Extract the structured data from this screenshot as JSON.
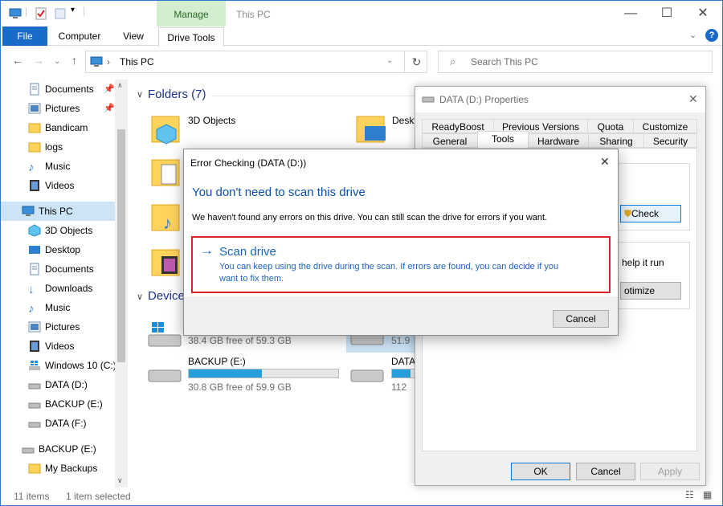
{
  "window": {
    "title": "This PC",
    "manage_tab": "Manage",
    "controls": {
      "minimize": "—",
      "maximize": "☐",
      "close": "✕"
    }
  },
  "ribbon": {
    "tabs": [
      "File",
      "Computer",
      "View",
      "Drive Tools"
    ],
    "help": "?"
  },
  "address": {
    "path": "This PC",
    "search_placeholder": "Search This PC"
  },
  "sidebar": {
    "quick_access": [
      {
        "label": "Documents",
        "icon": "documents-icon",
        "pinned": true
      },
      {
        "label": "Pictures",
        "icon": "pictures-icon",
        "pinned": true
      },
      {
        "label": "Bandicam",
        "icon": "folder-icon"
      },
      {
        "label": "logs",
        "icon": "folder-icon"
      },
      {
        "label": "Music",
        "icon": "music-icon"
      },
      {
        "label": "Videos",
        "icon": "videos-icon"
      }
    ],
    "this_pc": "This PC",
    "this_pc_items": [
      {
        "label": "3D Objects",
        "icon": "3d-objects-icon"
      },
      {
        "label": "Desktop",
        "icon": "desktop-icon"
      },
      {
        "label": "Documents",
        "icon": "documents-icon"
      },
      {
        "label": "Downloads",
        "icon": "downloads-icon"
      },
      {
        "label": "Music",
        "icon": "music-icon"
      },
      {
        "label": "Pictures",
        "icon": "pictures-icon"
      },
      {
        "label": "Videos",
        "icon": "videos-icon"
      },
      {
        "label": "Windows 10 (C:)",
        "icon": "windows-drive-icon"
      },
      {
        "label": "DATA (D:)",
        "icon": "drive-icon"
      },
      {
        "label": "BACKUP (E:)",
        "icon": "drive-icon"
      },
      {
        "label": "DATA (F:)",
        "icon": "drive-icon"
      }
    ],
    "backup_drive": "BACKUP (E:)",
    "backup_children": [
      {
        "label": "My Backups",
        "icon": "folder-icon"
      }
    ]
  },
  "main": {
    "folders_header": "Folders (7)",
    "folders": [
      "3D Objects",
      "Desktop"
    ],
    "devices_header": "Device",
    "drives": [
      {
        "name": "",
        "free": "38.4 GB free of 59.3 GB",
        "used_fraction": 0.35
      },
      {
        "name": "",
        "free": "51.9",
        "used_fraction": 0.1
      },
      {
        "name": "BACKUP (E:)",
        "free": "30.8 GB free of 59.9 GB",
        "used_fraction": 0.49
      },
      {
        "name": "DATA",
        "free": "112",
        "used_fraction": 0.2
      }
    ]
  },
  "status": {
    "items": "11 items",
    "selected": "1 item selected"
  },
  "properties": {
    "title": "DATA (D:) Properties",
    "close": "✕",
    "tabs_row1": [
      "ReadyBoost",
      "Previous Versions",
      "Quota",
      "Customize"
    ],
    "tabs_row2": [
      "General",
      "Tools",
      "Hardware",
      "Sharing",
      "Security"
    ],
    "check_button": "Check",
    "optimize_partial": "help it run",
    "optimize_button": "otimize",
    "ok": "OK",
    "cancel": "Cancel",
    "apply": "Apply"
  },
  "error_dialog": {
    "title": "Error Checking (DATA (D:))",
    "close": "✕",
    "heading": "You don't need to scan this drive",
    "message": "We haven't found any errors on this drive. You can still scan the drive for errors if you want.",
    "scan_title": "Scan drive",
    "scan_desc_1": "You can keep using the drive during the scan. If errors are found, you can decide if you",
    "scan_desc_2": "want to fix them.",
    "cancel": "Cancel",
    "colors": {
      "heading": "#0b4fa8",
      "highlight_border": "#d9242e",
      "scan_text": "#1e63b8"
    }
  }
}
